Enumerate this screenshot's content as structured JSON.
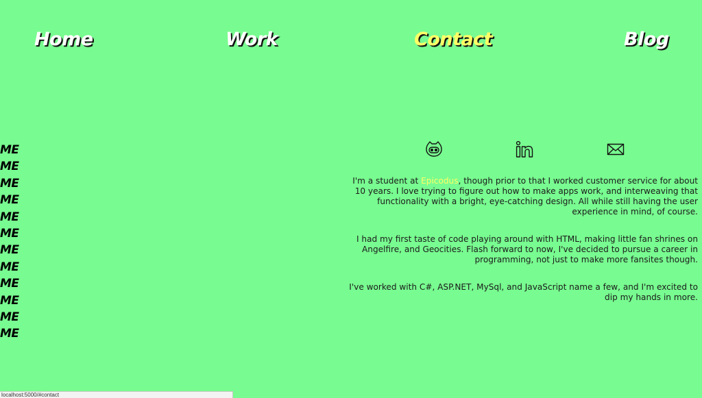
{
  "nav": {
    "items": [
      {
        "label": "Home"
      },
      {
        "label": "Work"
      },
      {
        "label": "Contact"
      },
      {
        "label": "Blog"
      }
    ],
    "active": "Contact",
    "active_color": "#ffff66",
    "text_color": "#ffffff"
  },
  "side": {
    "items": [
      "ME",
      "ME",
      "ME",
      "ME",
      "ME",
      "ME",
      "ME",
      "ME",
      "ME",
      "ME",
      "ME",
      "ME"
    ]
  },
  "social": {
    "icons": [
      "github-icon",
      "linkedin-icon",
      "email-icon"
    ]
  },
  "about": {
    "p1_before": "I'm a student at ",
    "p1_link": "Epicodus",
    "p1_after": ", though prior to that I worked customer service for about 10 years. I love trying to figure out how to make apps work, and interweaving that functionality with a bright, eye-catching design. All while still having the user experience in mind, of course.",
    "p2": "I had my first taste of code playing around with HTML, making little fan shrines on Angelfire, and Geocities. Flash forward to now, I've decided to pursue a career in programming, not just to make more fansites though.",
    "p3": "I've worked with C#, ASP.NET, MySql, and JavaScript name a few, and I'm excited to dip my hands in more."
  },
  "status_bar": {
    "url": "localhost:5000/#contact"
  },
  "colors": {
    "background": "#78fb90",
    "link_highlight": "#ffff66"
  }
}
